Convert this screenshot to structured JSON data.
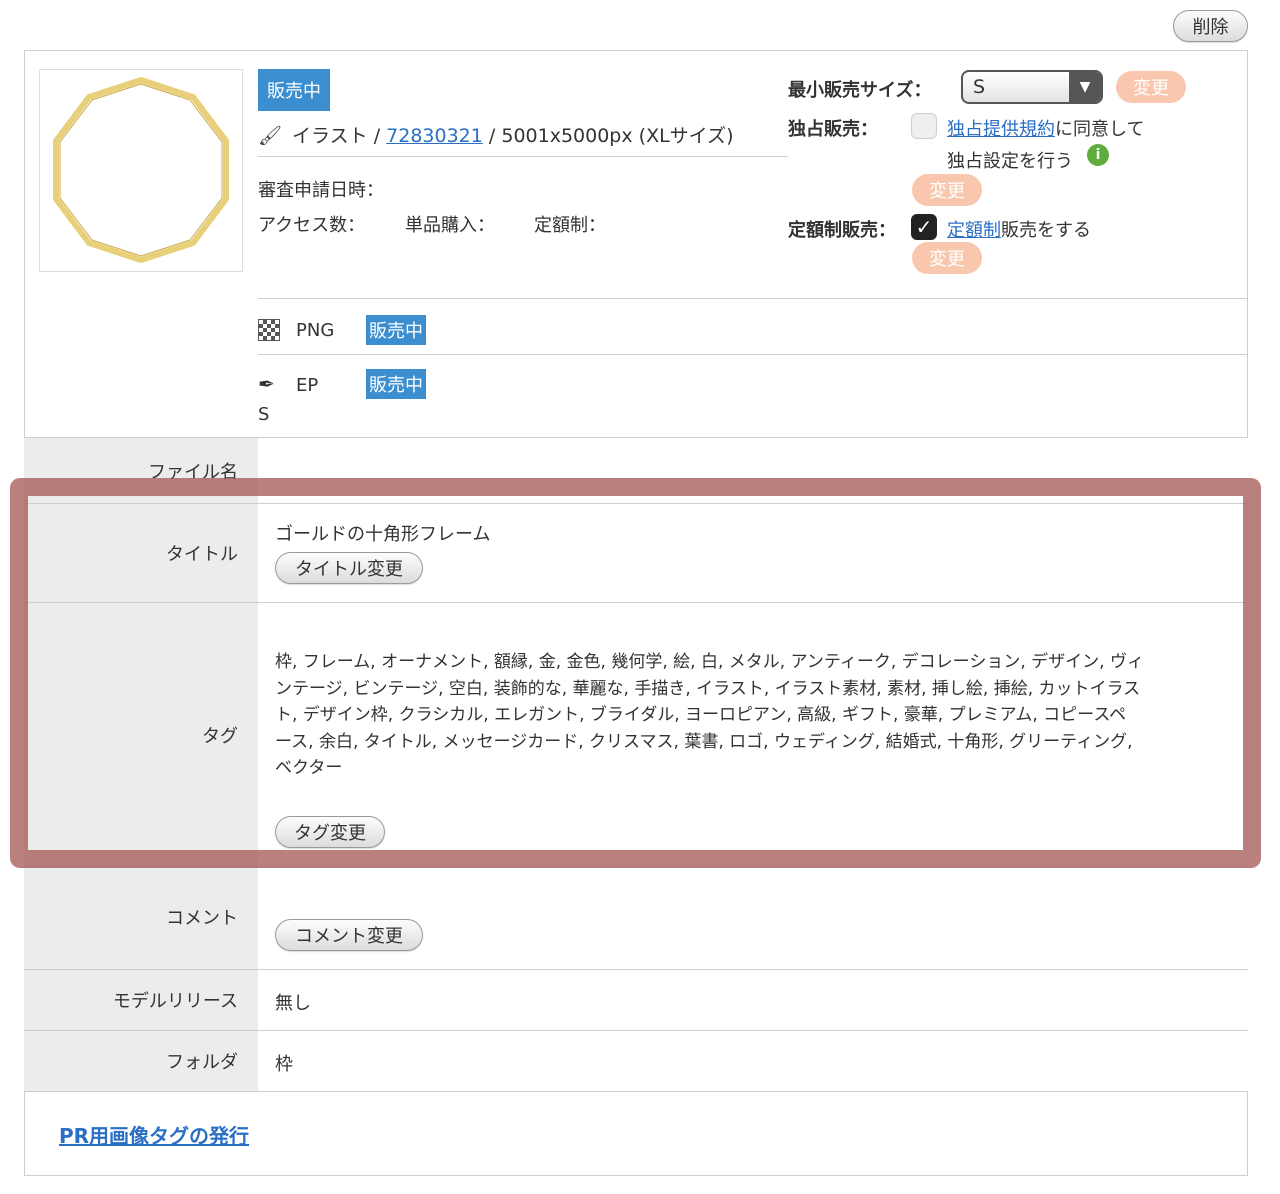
{
  "delete_label": "削除",
  "item": {
    "status_badge": "販売中",
    "type_label": "イラスト",
    "sep1": " / ",
    "id": "72830321",
    "sep2": " / ",
    "size_info": "5001x5000px (XLサイズ)",
    "review_date_label": "審査申請日時：",
    "access_label": "アクセス数：",
    "single_purchase_label": "単品購入：",
    "subscription_label": "定額制："
  },
  "settings": {
    "min_size_label": "最小販売サイズ：",
    "min_size_value": "S",
    "change_label": "変更",
    "exclusive_label": "独占販売：",
    "exclusive_link": "独占提供規約",
    "exclusive_text1": "に同意して",
    "exclusive_text2": "独占設定を行う",
    "subscription_sale_label": "定額制販売：",
    "subscription_link": "定額制",
    "subscription_text": "販売をする"
  },
  "formats": [
    {
      "name": "PNG",
      "status": "販売中"
    },
    {
      "name": "EP",
      "name_wrap": "S",
      "status": "販売中"
    }
  ],
  "rows": {
    "filename_label": "ファイル名",
    "title_label": "タイトル",
    "title_value": "ゴールドの十角形フレーム",
    "title_button": "タイトル変更",
    "tags_label": "タグ",
    "tags_lines": [
      "枠, フレーム, オーナメント, 額縁, 金, 金色, 幾何学, 絵, 白, メタル, アンティーク, デコレーション, デザイン, ヴィ",
      "ンテージ, ビンテージ, 空白, 装飾的な, 華麗な, 手描き, イラスト, イラスト素材, 素材, 挿し絵, 挿絵, カットイラス",
      "ト, デザイン枠, クラシカル, エレガント, ブライダル, ヨーロピアン, 高級, ギフト, 豪華, プレミアム, コピースペ",
      "ース, 余白, タイトル, メッセージカード, クリスマス, 葉書, ロゴ, ウェディング, 結婚式, 十角形, グリーティング,",
      "ベクター"
    ],
    "tags_button": "タグ変更",
    "comment_label": "コメント",
    "comment_button": "コメント変更",
    "model_release_label": "モデルリリース",
    "model_release_value": "無し",
    "folder_label": "フォルダ",
    "folder_value": "枠"
  },
  "pr_link": "PR用画像タグの発行",
  "colors": {
    "badge_blue": "#3b8fd0",
    "link_blue": "#2a6fc4",
    "orange_button": "#f9c7ad",
    "highlight": "#a8605e",
    "frame_gold": "#e8cf7a"
  }
}
